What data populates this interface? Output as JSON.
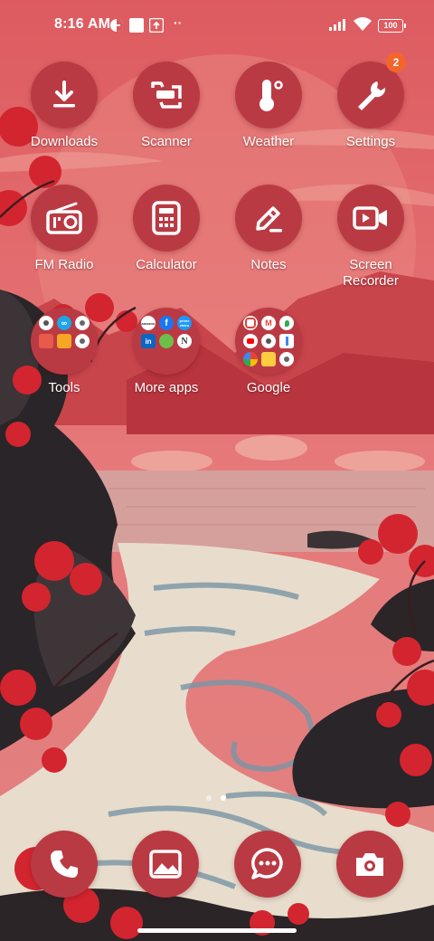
{
  "status_bar": {
    "time": "8:16 AM",
    "battery": "100",
    "icons": [
      "do-not-disturb-icon",
      "app-notification-icon",
      "upload-icon",
      "more-notifications-icon",
      "signal-icon",
      "wifi-icon",
      "battery-icon"
    ]
  },
  "apps": [
    {
      "label": "Downloads",
      "icon": "download-icon"
    },
    {
      "label": "Scanner",
      "icon": "scanner-icon"
    },
    {
      "label": "Weather",
      "icon": "thermometer-icon"
    },
    {
      "label": "Settings",
      "icon": "wrench-icon",
      "badge": "2"
    },
    {
      "label": "FM Radio",
      "icon": "radio-icon"
    },
    {
      "label": "Calculator",
      "icon": "calculator-icon"
    },
    {
      "label": "Notes",
      "icon": "pencil-icon"
    },
    {
      "label": "Screen Recorder",
      "icon": "video-camera-icon"
    }
  ],
  "folders": [
    {
      "label": "Tools"
    },
    {
      "label": "More apps",
      "apps": [
        "amazon",
        "f",
        "prime video",
        "in",
        "N"
      ]
    },
    {
      "label": "Google"
    }
  ],
  "dock": [
    {
      "name": "Phone",
      "icon": "phone-icon"
    },
    {
      "name": "Gallery",
      "icon": "gallery-icon"
    },
    {
      "name": "Messages",
      "icon": "chat-icon"
    },
    {
      "name": "Camera",
      "icon": "camera-icon"
    }
  ],
  "colors": {
    "icon_bg": "#ba3a44",
    "badge": "#f3652b",
    "sky": "#e06a6c",
    "water": "#e8ddcc"
  },
  "page_indicator": {
    "pages": 2,
    "current": 2
  }
}
